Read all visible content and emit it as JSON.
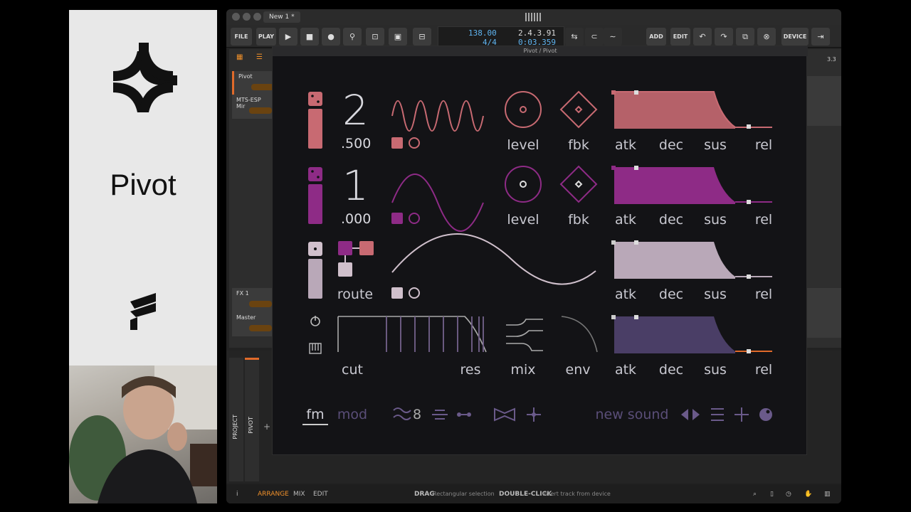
{
  "branding": {
    "name": "Pivot"
  },
  "window": {
    "tab_label": "New 1 *",
    "plugin_title": "Pivot / Pivot"
  },
  "toolbar": {
    "file": "FILE",
    "play": "PLAY",
    "add": "ADD",
    "edit": "EDIT",
    "device": "DEVICE",
    "tempo": "138.00",
    "signature": "4/4",
    "position": "2.4.3.91",
    "time": "0:03.359"
  },
  "tracks": [
    {
      "name": "Pivot"
    },
    {
      "name": "MTS-ESP Mir"
    },
    {
      "name": "FX 1"
    },
    {
      "name": "Master"
    }
  ],
  "timeline": {
    "marker": "3.3"
  },
  "vertical_tabs": {
    "project": "PROJECT",
    "pivot": "PIVOT"
  },
  "operators": [
    {
      "ratio_int": "2",
      "ratio_frac": ".500",
      "color": "#c86a72",
      "labels": [
        "level",
        "fbk"
      ],
      "env": [
        "atk",
        "dec",
        "sus",
        "rel"
      ]
    },
    {
      "ratio_int": "1",
      "ratio_frac": ".000",
      "color": "#8e2b86",
      "labels": [
        "level",
        "fbk"
      ],
      "env": [
        "atk",
        "dec",
        "sus",
        "rel"
      ]
    },
    {
      "route_label": "route",
      "color": "#b9a8b8",
      "env": [
        "atk",
        "dec",
        "sus",
        "rel"
      ]
    },
    {
      "filter_labels": [
        "cut",
        "res",
        "mix",
        "env"
      ],
      "color": "#5a4a78",
      "env": [
        "atk",
        "dec",
        "sus",
        "rel"
      ]
    }
  ],
  "footer": {
    "tab_fm": "fm",
    "tab_mod": "mod",
    "voices": "8",
    "preset": "new sound"
  },
  "statusbar": {
    "arrange": "ARRANGE",
    "mix": "MIX",
    "edit": "EDIT",
    "drag": "DRAG",
    "drag_hint": "Rectangular selection",
    "dbl": "DOUBLE-CLICK",
    "dbl_hint": "Insert track from device"
  }
}
